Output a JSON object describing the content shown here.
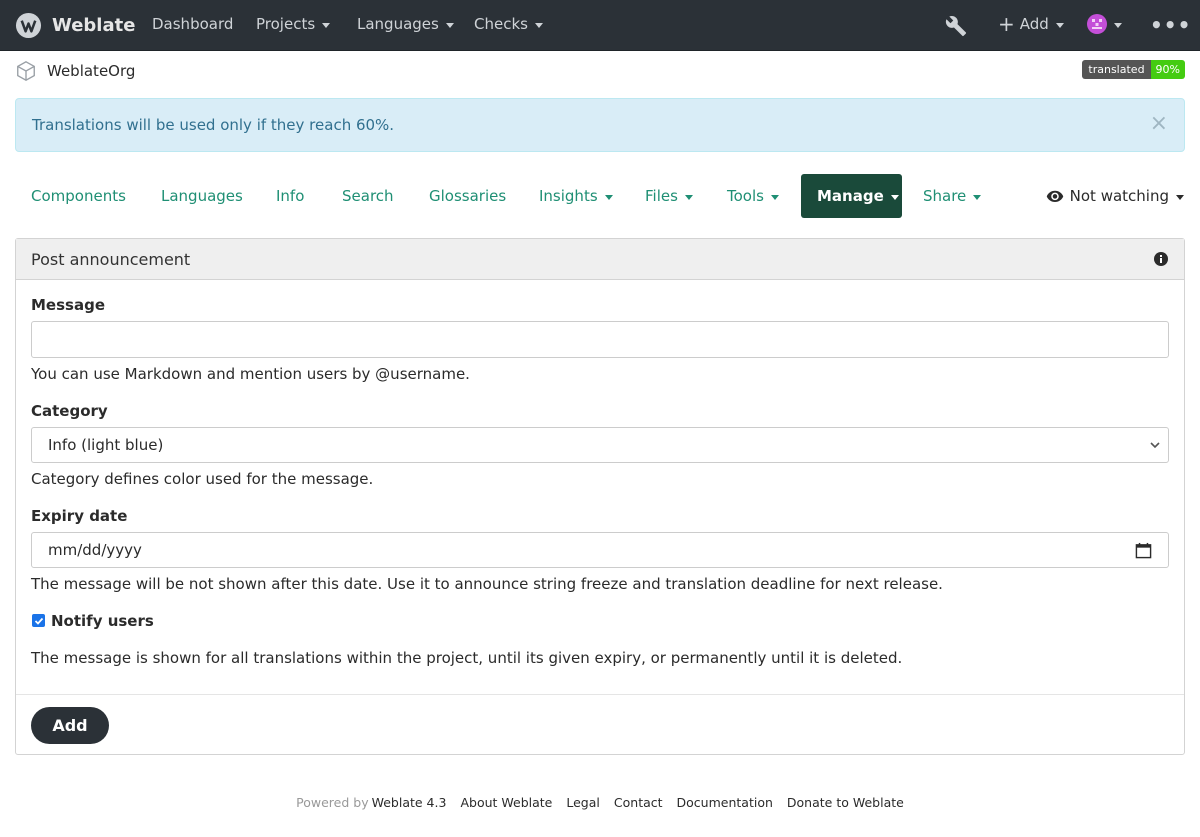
{
  "navbar": {
    "brand": "Weblate",
    "items": [
      {
        "label": "Dashboard",
        "caret": false
      },
      {
        "label": "Projects",
        "caret": true
      },
      {
        "label": "Languages",
        "caret": true
      },
      {
        "label": "Checks",
        "caret": true
      }
    ],
    "add_label": "Add"
  },
  "breadcrumb": {
    "project": "WeblateOrg"
  },
  "badge": {
    "label": "translated",
    "value": "90%"
  },
  "alert": {
    "text": "Translations will be used only if they reach 60%.",
    "close": "×"
  },
  "tabs": [
    {
      "label": "Components",
      "caret": false
    },
    {
      "label": "Languages",
      "caret": false
    },
    {
      "label": "Info",
      "caret": false
    },
    {
      "label": "Search",
      "caret": false
    },
    {
      "label": "Glossaries",
      "caret": false
    },
    {
      "label": "Insights",
      "caret": true
    },
    {
      "label": "Files",
      "caret": true
    },
    {
      "label": "Tools",
      "caret": true
    },
    {
      "label": "Manage",
      "caret": true,
      "active": true
    },
    {
      "label": "Share",
      "caret": true
    }
  ],
  "watch": {
    "label": "Not watching"
  },
  "panel": {
    "title": "Post announcement",
    "message": {
      "label": "Message",
      "value": "",
      "help": "You can use Markdown and mention users by @username."
    },
    "category": {
      "label": "Category",
      "selected": "Info (light blue)",
      "help": "Category defines color used for the message."
    },
    "expiry": {
      "label": "Expiry date",
      "placeholder": "mm/dd/yyyy",
      "help": "The message will be not shown after this date. Use it to announce string freeze and translation deadline for next release."
    },
    "notify": {
      "label": "Notify users",
      "checked": true
    },
    "note": "The message is shown for all translations within the project, until its given expiry, or permanently until it is deleted.",
    "submit": "Add"
  },
  "footer": {
    "powered_by": "Powered by",
    "version": "Weblate 4.3",
    "links": [
      "About Weblate",
      "Legal",
      "Contact",
      "Documentation",
      "Donate to Weblate"
    ]
  },
  "colors": {
    "navbar": "#2b3137",
    "accent": "#1f8f74",
    "active_tab": "#1a4a3a",
    "alert_bg": "#d9edf7",
    "alert_text": "#31708f",
    "badge_green": "#44cc11"
  }
}
